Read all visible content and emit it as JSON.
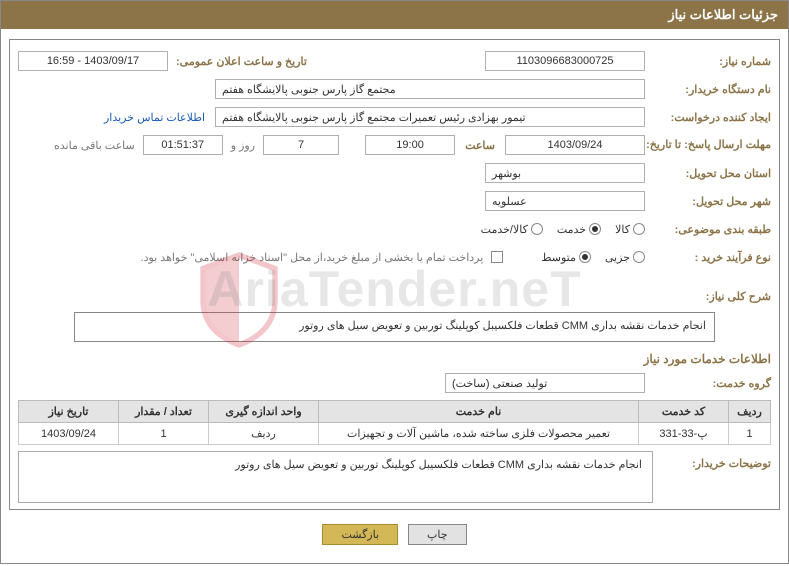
{
  "header": {
    "title": "جزئیات اطلاعات نیاز"
  },
  "fields": {
    "need_no_label": "شماره نیاز:",
    "need_no": "1103096683000725",
    "announce_label": "تاریخ و ساعت اعلان عمومی:",
    "announce_value": "1403/09/17 - 16:59",
    "buyer_org_label": "نام دستگاه خریدار:",
    "buyer_org": "مجتمع گاز پارس جنوبی  پالایشگاه هفتم",
    "requestor_label": "ایجاد کننده درخواست:",
    "requestor": "تیمور بهزادی رئیس تعمیرات مجتمع گاز پارس جنوبی  پالایشگاه هفتم",
    "contact_link": "اطلاعات تماس خریدار",
    "deadline_label": "مهلت ارسال پاسخ: تا تاریخ:",
    "deadline_date": "1403/09/24",
    "time_label": "ساعت",
    "deadline_time": "19:00",
    "days_value": "7",
    "days_suffix": "روز و",
    "countdown": "01:51:37",
    "countdown_suffix": "ساعت باقی مانده",
    "province_label": "استان محل تحویل:",
    "province": "بوشهر",
    "city_label": "شهر محل تحویل:",
    "city": "عسلویه",
    "category_label": "طبقه بندی موضوعی:",
    "cat_kala": "کالا",
    "cat_khadamat": "خدمت",
    "cat_both": "کالا/خدمت",
    "process_label": "نوع فرآیند خرید :",
    "process_jozei": "جزیی",
    "process_motavaset": "متوسط",
    "payment_note": "پرداخت تمام یا بخشی از مبلغ خرید،از محل \"اسناد خزانه اسلامی\" خواهد بود.",
    "general_desc_label": "شرح کلی نیاز:",
    "general_desc": "انجام خدمات نقشه بداری CMM قطعات فلکسیبل کوپلینگ توربین و تعویض سیل های روتور",
    "services_info_label": "اطلاعات خدمات مورد نیاز",
    "service_group_label": "گروه خدمت:",
    "service_group": "تولید صنعتی (ساخت)",
    "buyer_notes_label": "توضیحات خریدار:",
    "buyer_notes": "انجام خدمات نقشه بداری CMM قطعات فلکسیبل کوپلینگ توربین و تعویض سیل های روتور"
  },
  "table": {
    "headers": {
      "row": "ردیف",
      "code": "کد خدمت",
      "name": "نام خدمت",
      "unit": "واحد اندازه گیری",
      "qty": "تعداد / مقدار",
      "date": "تاریخ نیاز"
    },
    "rows": [
      {
        "row": "1",
        "code": "پ-33-331",
        "name": "تعمیر محصولات فلزی ساخته شده، ماشین آلات و تجهیزات",
        "unit": "ردیف",
        "qty": "1",
        "date": "1403/09/24"
      }
    ]
  },
  "buttons": {
    "print": "چاپ",
    "back": "بازگشت"
  },
  "watermark": {
    "text": "AriaTender.neT"
  }
}
